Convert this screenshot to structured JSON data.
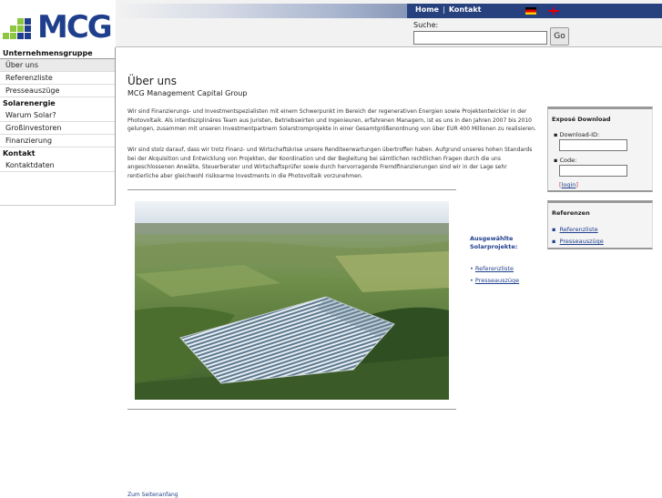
{
  "brand": {
    "logo_text": "MCG"
  },
  "top_nav": {
    "home": "Home",
    "contact": "Kontakt"
  },
  "search": {
    "label": "Suche:",
    "button": "Go",
    "value": ""
  },
  "sidebar": {
    "sections": [
      {
        "heading": "Unternehmensgruppe",
        "items": [
          "Über uns",
          "Referenzliste",
          "Presseauszüge"
        ]
      },
      {
        "heading": "Solarenergie",
        "items": [
          "Warum Solar?",
          "Großinvestoren",
          "Finanzierung"
        ]
      },
      {
        "heading": "Kontakt",
        "items": [
          "Kontaktdaten"
        ]
      }
    ]
  },
  "main": {
    "title": "Über uns",
    "subtitle": "MCG Management Capital Group",
    "paragraph_1": "Wir sind Finanzierungs- und Investmentspezialisten mit einem Schwerpunkt im Bereich der regenerativen Energien sowie Projektentwickler in der Photovoltaik. Als interdisziplinäres Team aus Juristen, Betriebswirten und Ingenieuren, erfahrenen Managern, ist es uns in den Jahren 2007 bis 2010 gelungen, zusammen mit unseren Investmentpartnern Solarstromprojekte in einer Gesamtgrößenordnung von über EUR 400 Millionen zu realisieren.",
    "paragraph_2": "Wir sind stolz darauf, dass wir trotz Finanz- und Wirtschaftskrise unsere Renditeerwartungen übertroffen haben. Aufgrund unseres hohen Standards bei der Akquisition und Entwicklung von Projekten, der Koordination und der Begleitung bei sämtlichen rechtlichen Fragen durch die uns angeschlossenen Anwälte, Steuerberater und Wirtschaftsprüfer sowie durch hervorragende Fremdfinanzierungen sind wir in der Lage sehr rentierliche aber gleichwohl risikoarme Investments in die Photovoltaik vorzunehmen.",
    "projects_heading": "Ausgewählte Solarprojekte:",
    "project_links": [
      "Referenzliste",
      "Presseauszüge"
    ],
    "back_link": "Zum Seitenanfang"
  },
  "expose_panel": {
    "title": "Exposé Download",
    "download_label": "Download-ID:",
    "code_label": "Code:",
    "login_link": "login"
  },
  "ref_panel": {
    "title": "Referenzen",
    "links": [
      "Referenzliste",
      "Presseauszüge"
    ]
  },
  "colors": {
    "brand_blue": "#1f3f8c",
    "logo_green": "#8dc63f",
    "header_band": "#27407e"
  }
}
